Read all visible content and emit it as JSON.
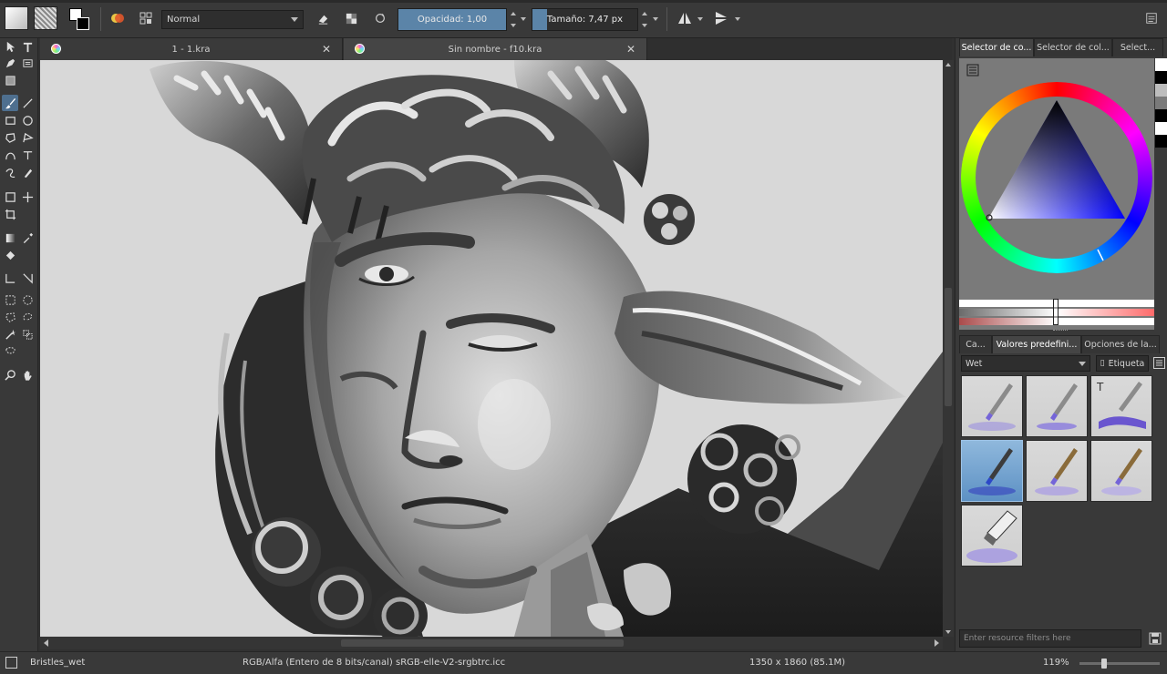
{
  "toolbar": {
    "blend_mode": "Normal",
    "opacity_label": "Opacidad: 1,00",
    "opacity_fraction": 1.0,
    "size_label": "Tamaño: 7,47 px",
    "size_fraction": 0.14
  },
  "documents": {
    "tabs": [
      {
        "label": "1 - 1.kra",
        "active": false
      },
      {
        "label": "Sin nombre - f10.kra",
        "active": true
      }
    ]
  },
  "docker": {
    "top_tabs": [
      "Selector de co...",
      "Selector de col...",
      "Select..."
    ],
    "preset_tabs": [
      "Ca...",
      "Valores predefini...",
      "Opciones de la..."
    ],
    "preset_tag": "Wet",
    "tag_button": "Etiqueta",
    "filter_placeholder": "Enter resource filters here",
    "palette_colors": [
      "#ffffff",
      "#000000",
      "#bdbdbd",
      "#7a7a7a",
      "#000000",
      "#ffffff",
      "#000000"
    ]
  },
  "status": {
    "brush_name": "Bristles_wet",
    "color_space": "RGB/Alfa (Entero de 8 bits/canal)  sRGB-elle-V2-srgbtrc.icc",
    "dimensions": "1350 x 1860 (85.1M)",
    "zoom": "119%"
  },
  "colors": {
    "accent": "#5b84a8",
    "bg": "#313131",
    "panel": "#393939"
  }
}
